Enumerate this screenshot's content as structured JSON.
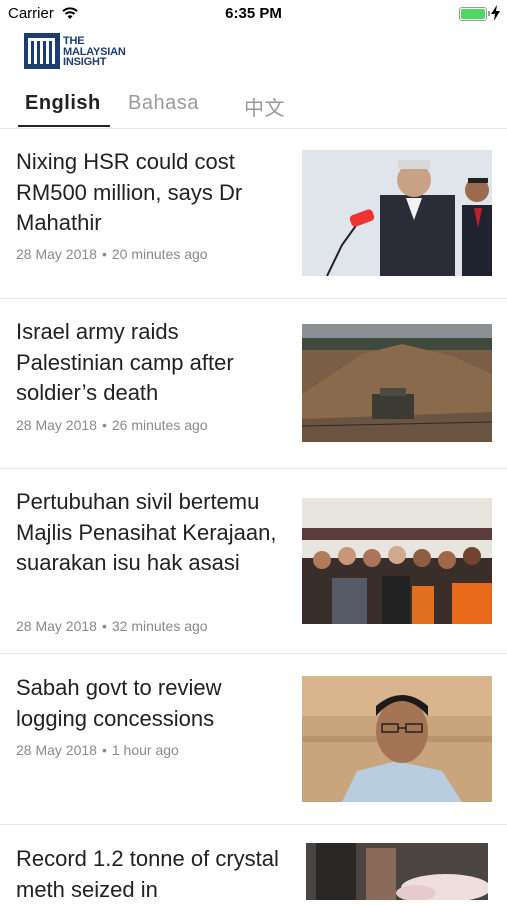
{
  "status_bar": {
    "carrier": "Carrier",
    "time": "6:35 PM"
  },
  "logo": {
    "line1": "THE",
    "line2": "MALAYSIAN",
    "line3": "INSIGHT"
  },
  "tabs": [
    {
      "label": "English",
      "active": true
    },
    {
      "label": "Bahasa",
      "active": false
    },
    {
      "label": "中文",
      "active": false
    }
  ],
  "articles": [
    {
      "headline": "Nixing HSR could cost RM500 million, says Dr Mahathir",
      "date": "28 May 2018",
      "ago": "20 minutes ago",
      "image": "photo-speaker-microphone"
    },
    {
      "headline": "Israel army raids Palestinian camp after soldier’s death",
      "date": "28 May 2018",
      "ago": "26 minutes ago",
      "image": "photo-military-vehicle"
    },
    {
      "headline": "Pertubuhan sivil bertemu Majlis Penasihat Kerajaan, suarakan isu hak asasi",
      "date": "28 May 2018",
      "ago": "32 minutes ago",
      "image": "photo-group-thumbs-up"
    },
    {
      "headline": "Sabah govt to review logging concessions",
      "date": "28 May 2018",
      "ago": "1 hour ago",
      "image": "photo-man-portrait"
    },
    {
      "headline": "Record 1.2 tonne of crystal meth seized in",
      "image": "photo-seized-drugs"
    }
  ],
  "colors": {
    "brand": "#1e3d6e",
    "battery": "#4cd964",
    "divider": "#e6e6e6",
    "meta": "#8a8a8a"
  }
}
